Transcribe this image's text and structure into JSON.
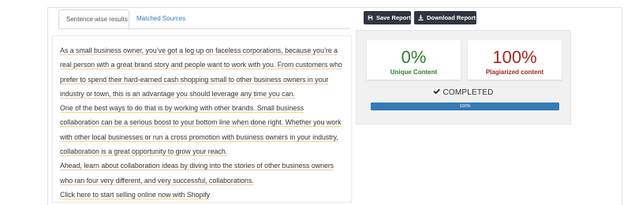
{
  "tabs": [
    {
      "label": "Sentence wise results",
      "active": true
    },
    {
      "label": "Matched Sources",
      "active": false
    }
  ],
  "toolbar": {
    "save_label": "Save Report",
    "download_label": "Download Report"
  },
  "results": {
    "unique_percent": "0%",
    "unique_label": "Unique Content",
    "plagiarized_percent": "100%",
    "plagiarized_label": "Plagiarized content",
    "status_text": "COMPLETED",
    "progress_label": "100%",
    "progress_fraction": 1.0
  },
  "colors": {
    "unique": "#2e7d32",
    "plagiarized": "#a12a1c",
    "button_bg": "#2f3640",
    "progress": "#337ab7",
    "link": "#337ab7"
  },
  "icons": {
    "save": "save-icon",
    "download": "download-icon",
    "completed": "check-icon"
  },
  "text": [
    "As a small business owner, you’ve got a leg up on faceless corporations, because you’re a real person with a great brand story and people want to work with you. From customers who prefer to spend their hard-earned cash shopping small to other business owners in your industry or town, this is an advantage you should leverage any time you can.",
    "One of the best ways to do that is by working with other brands. Small business collaboration can be a serious boost to your bottom line when done right. Whether you work with other local businesses or run a cross promotion with business owners in your industry, collaboration is a great opportunity to grow your reach.",
    "Ahead, learn about collaboration ideas by diving into the stories of other business owners who ran four very different, and very successful, collaborations.",
    "Click here to start selling online now with Shopify"
  ]
}
